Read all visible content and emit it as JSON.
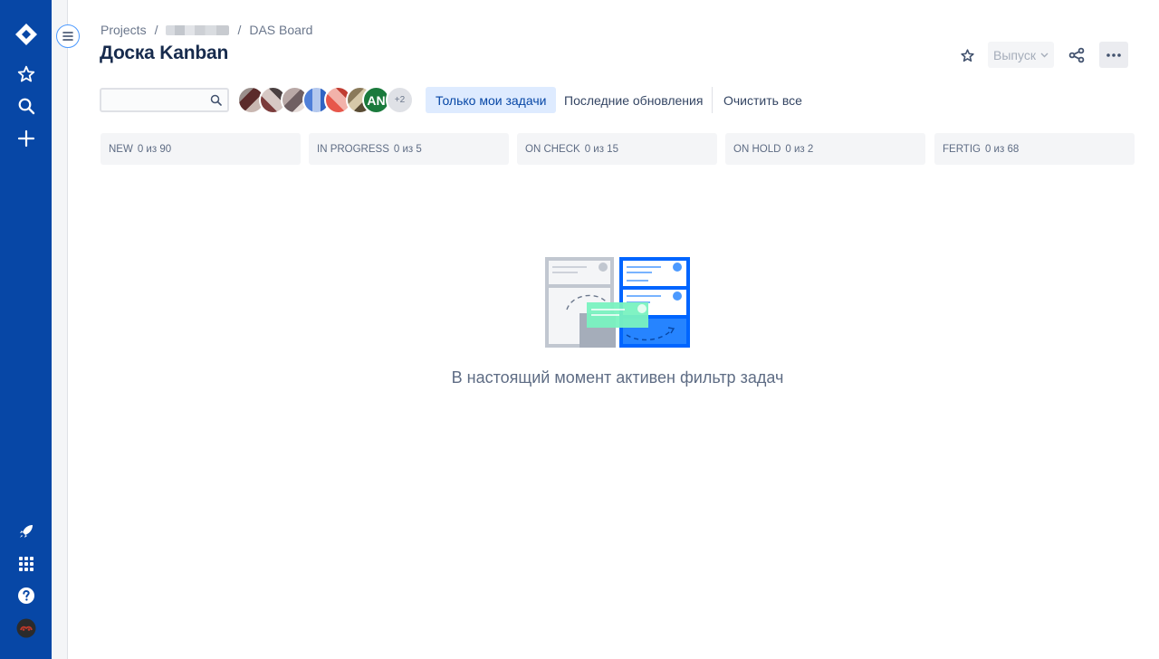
{
  "global_nav": {
    "icons": [
      "jira-logo-icon",
      "star-icon",
      "search-icon",
      "plus-icon",
      "rocket-icon",
      "app-switcher-icon",
      "help-icon",
      "user-avatar"
    ]
  },
  "breadcrumb": {
    "items": [
      "Projects",
      "DAS Board"
    ],
    "separator": "/"
  },
  "page_title": "Доска Kanban",
  "header_actions": {
    "release_label": "Выпуск"
  },
  "search": {
    "value": "",
    "placeholder": ""
  },
  "avatars": {
    "initials": "AN",
    "more_count": "+2"
  },
  "quick_filters": {
    "only_my_issues": "Только мои задачи",
    "recent_updates": "Последние обновления",
    "clear_all": "Очистить все"
  },
  "columns": [
    {
      "name": "NEW",
      "count": "0 из 90"
    },
    {
      "name": "IN PROGRESS",
      "count": "0 из 5"
    },
    {
      "name": "ON CHECK",
      "count": "0 из 15"
    },
    {
      "name": "ON HOLD",
      "count": "0 из 2"
    },
    {
      "name": "FERTIG",
      "count": "0 из 68"
    }
  ],
  "empty_state": {
    "message": "В настоящий момент активен фильтр задач"
  },
  "colors": {
    "nav_bg": "#0747a6",
    "active_filter_bg": "#deebff",
    "column_bg": "#f4f5f7",
    "text_primary": "#172b4d",
    "text_secondary": "#5e6c84"
  }
}
